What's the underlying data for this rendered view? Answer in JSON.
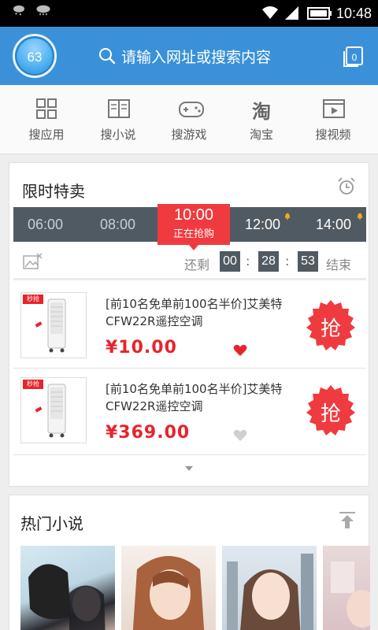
{
  "status_bar": {
    "time": "10:48"
  },
  "header": {
    "avatar_value": "63",
    "search_placeholder": "请输入网址或搜索内容"
  },
  "quick_nav": [
    {
      "label": "搜应用",
      "icon": "apps-grid-icon"
    },
    {
      "label": "搜小说",
      "icon": "book-icon"
    },
    {
      "label": "搜游戏",
      "icon": "gamepad-icon"
    },
    {
      "label": "淘宝",
      "icon": "taobao-icon",
      "icon_text": "淘"
    },
    {
      "label": "搜视频",
      "icon": "video-icon"
    }
  ],
  "flash_sale": {
    "title": "限时特卖",
    "slots": [
      "06:00",
      "08:00",
      "12:00",
      "14:00"
    ],
    "active_slot": {
      "time": "10:00",
      "status": "正在抢购"
    },
    "countdown": {
      "prefix": "还剩",
      "hours": "00",
      "minutes": "28",
      "seconds": "53",
      "suffix": "结束",
      "colon": ":"
    },
    "products": [
      {
        "name": "[前10名免单前100名半价]艾美特CFW22R遥控空调",
        "price": "¥10.00",
        "favorited": true,
        "grab_label": "抢",
        "badge": "秒抢"
      },
      {
        "name": "[前10名免单前100名半价]艾美特CFW22R遥控空调",
        "price": "¥369.00",
        "favorited": false,
        "grab_label": "抢",
        "badge": "秒抢"
      }
    ]
  },
  "hot_novels": {
    "title": "热门小说"
  },
  "colors": {
    "accent": "#3a91d9",
    "sale_red": "#ef3b3f",
    "timebar": "#505a62"
  }
}
